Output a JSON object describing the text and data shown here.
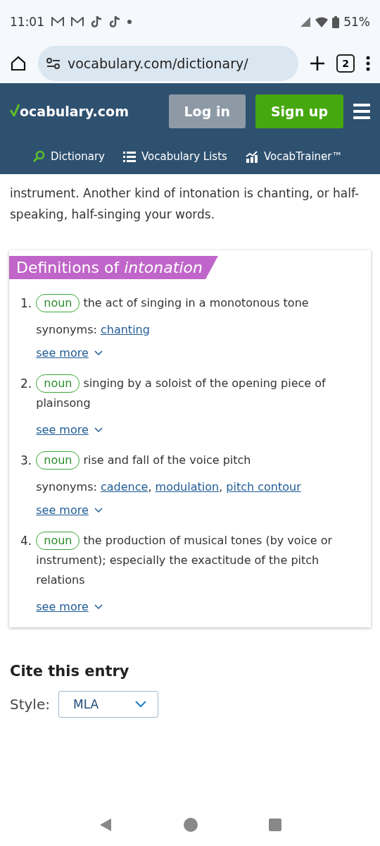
{
  "status_bar": {
    "time": "11:01",
    "battery": "51%"
  },
  "browser": {
    "url": "vocabulary.com/dictionary/",
    "tab_count": "2"
  },
  "header": {
    "logo": "ocabulary.com",
    "login": "Log in",
    "signup": "Sign up",
    "nav": [
      "Dictionary",
      "Vocabulary Lists",
      "VocabTrainer™"
    ]
  },
  "intro": [
    "instrument. Another kind of intonation is chanting, or half-",
    "speaking, half-singing your words."
  ],
  "definitions": {
    "title": "Definitions of *intonation*",
    "items": [
      {
        "number": "1.",
        "pos": "noun",
        "text": "the act of singing in a monotonous tone",
        "synonyms_label": "synonyms:",
        "synonyms": [
          {
            "word": "chanting"
          }
        ],
        "see_more": "see more"
      },
      {
        "number": "2.",
        "pos": "noun",
        "text": "singing by a soloist of the opening piece of plainsong",
        "see_more": "see more"
      },
      {
        "number": "3.",
        "pos": "noun",
        "text": "rise and fall of the voice pitch",
        "synonyms_label": "synonyms:",
        "synonyms": [
          {
            "word": "cadence",
            "separator": ","
          },
          {
            "word": "modulation",
            "separator": ","
          },
          {
            "word": "pitch contour"
          }
        ],
        "see_more": "see more"
      },
      {
        "number": "4.",
        "pos": "noun",
        "text": "the production of musical tones (by voice or instrument); especially the exactitude of the pitch relations",
        "see_more": "see more"
      }
    ]
  },
  "cite": {
    "title": "Cite this entry",
    "style_label": "Style:",
    "style_value": "MLA"
  }
}
